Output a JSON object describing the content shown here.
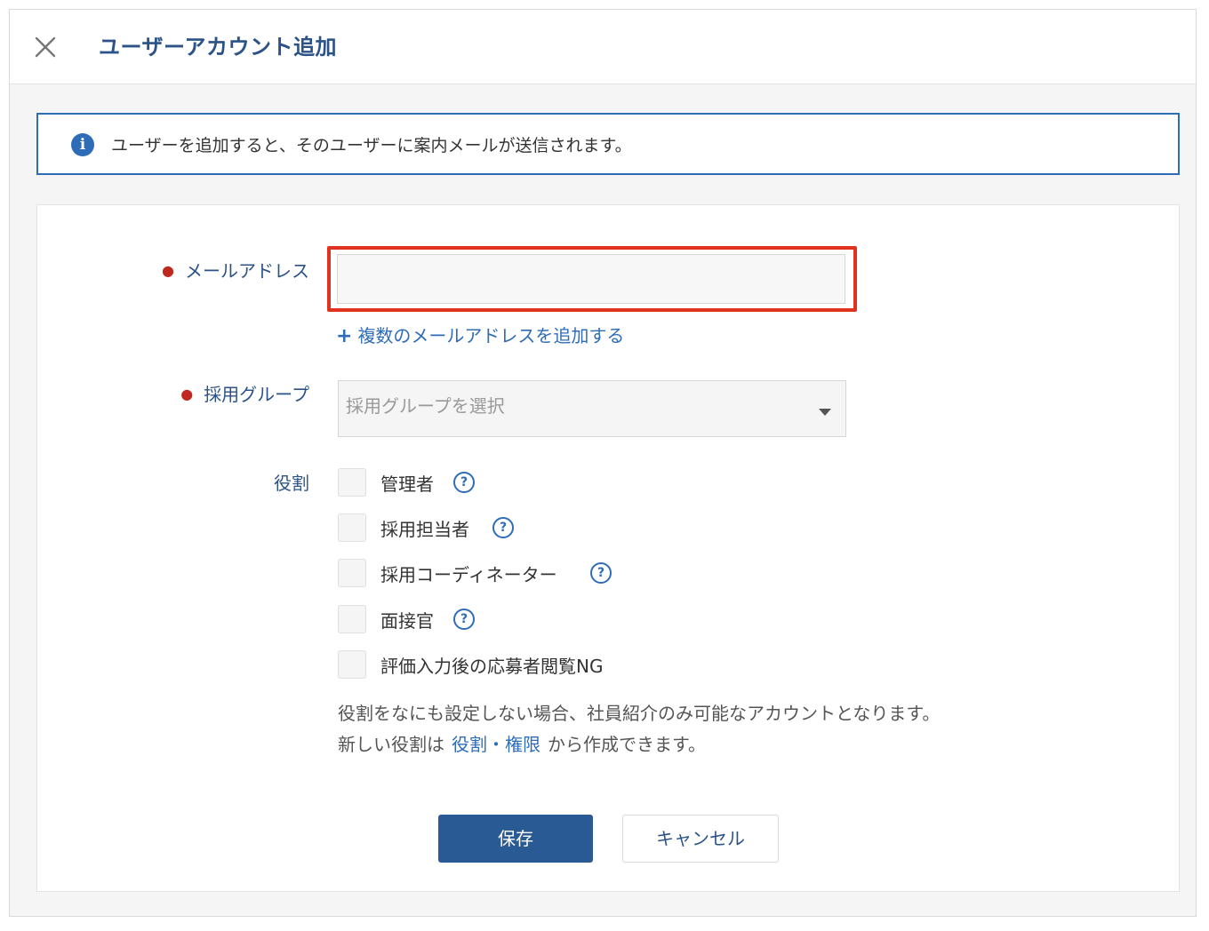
{
  "dialog": {
    "title": "ユーザーアカウント追加",
    "close_icon": "close-icon"
  },
  "notice": {
    "icon": "info-icon",
    "text": "ユーザーを追加すると、そのユーザーに案内メールが送信されます。"
  },
  "form": {
    "email": {
      "label": "メールアドレス",
      "required": true,
      "value": "",
      "placeholder": ""
    },
    "add_multiple_email": {
      "plus": "+",
      "label": "複数のメールアドレスを追加する"
    },
    "group": {
      "label": "採用グループ",
      "required": true,
      "placeholder": "採用グループを選択"
    },
    "roles": {
      "label": "役割",
      "items": [
        {
          "label": "管理者",
          "help": true,
          "checked": false
        },
        {
          "label": "採用担当者",
          "help": true,
          "checked": false
        },
        {
          "label": "採用コーディネーター",
          "help": true,
          "checked": false
        },
        {
          "label": "面接官",
          "help": true,
          "checked": false
        },
        {
          "label": "評価入力後の応募者閲覧NG",
          "help": false,
          "checked": false
        }
      ],
      "help_glyph": "?"
    },
    "notes": {
      "line1": "役割をなにも設定しない場合、社員紹介のみ可能なアカウントとなります。",
      "line2_prefix": "新しい役割は",
      "line2_link": "役割・権限",
      "line2_suffix": "から作成できます。"
    }
  },
  "buttons": {
    "save": "保存",
    "cancel": "キャンセル"
  },
  "colors": {
    "accent": "#2f6cb8",
    "title": "#2b5387",
    "primary_button": "#2a5a93",
    "required_dot": "#c0281f",
    "highlight": "#e0321f"
  }
}
